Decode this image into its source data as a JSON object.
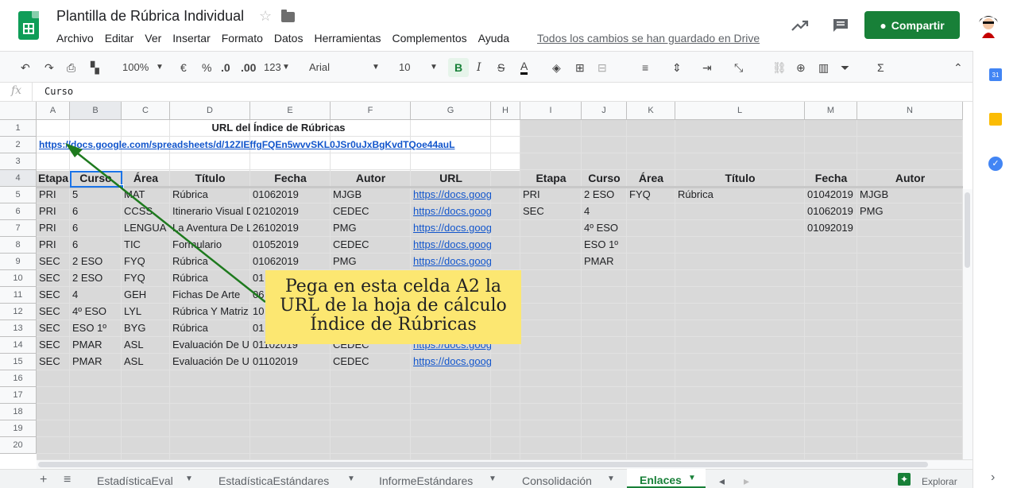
{
  "header": {
    "title": "Plantilla de Rúbrica Individual",
    "menu": [
      "Archivo",
      "Editar",
      "Ver",
      "Insertar",
      "Formato",
      "Datos",
      "Herramientas",
      "Complementos",
      "Ayuda"
    ],
    "saved_status": "Todos los cambios se han guardado en Drive",
    "share_label": "Compartir",
    "accent": "#188038"
  },
  "toolbar": {
    "zoom": "100%",
    "currency": "€",
    "percent": "%",
    "dec_less": ".0",
    "dec_more": ".00",
    "more_formats": "123",
    "font": "Arial",
    "font_size": "10",
    "bold": "B"
  },
  "formula_bar": {
    "fx": "fx",
    "value": "Curso"
  },
  "columns": [
    "A",
    "B",
    "C",
    "D",
    "E",
    "F",
    "G",
    "H",
    "I",
    "J",
    "K",
    "L",
    "M",
    "N"
  ],
  "rows": [
    "1",
    "2",
    "3",
    "4",
    "5",
    "6",
    "7",
    "8",
    "9",
    "10",
    "11",
    "12",
    "13",
    "14",
    "15",
    "16",
    "17",
    "18",
    "19",
    "20"
  ],
  "sheet": {
    "title_cell": "URL del Índice de Rúbricas",
    "url_cell": "https://docs.google.com/spreadsheets/d/12ZIEffgFQEn5wvvSKL0JSr0uJxBgKvdTQoe44auL",
    "left_headers": [
      "Etapa",
      "Curso",
      "Área",
      "Título",
      "Fecha",
      "Autor",
      "URL"
    ],
    "left_rows": [
      [
        "PRI",
        "5",
        "MAT",
        "Rúbrica",
        "01062019",
        "MJGB",
        "https://docs.goog"
      ],
      [
        "PRI",
        "6",
        "CCSS",
        "Itinerario Visual D",
        "02102019",
        "CEDEC",
        "https://docs.goog"
      ],
      [
        "PRI",
        "6",
        "LENGUA",
        "La Aventura De L",
        "26102019",
        "PMG",
        "https://docs.goog"
      ],
      [
        "PRI",
        "6",
        "TIC",
        "Formulario",
        "01052019",
        "CEDEC",
        "https://docs.goog"
      ],
      [
        "SEC",
        "2 ESO",
        "FYQ",
        "Rúbrica",
        "01062019",
        "PMG",
        "https://docs.goog"
      ],
      [
        "SEC",
        "2 ESO",
        "FYQ",
        "Rúbrica",
        "01",
        "",
        ""
      ],
      [
        "SEC",
        "4",
        "GEH",
        "Fichas De Arte",
        "06",
        "",
        ""
      ],
      [
        "SEC",
        "4º ESO",
        "LYL",
        "Rúbrica Y Matriz",
        "10",
        "",
        ""
      ],
      [
        "SEC",
        "ESO 1º",
        "BYG",
        "Rúbrica",
        "01",
        "",
        ""
      ],
      [
        "SEC",
        "PMAR",
        "ASL",
        "Evaluación De U",
        "01102019",
        "CEDEC",
        "https://docs.goog"
      ],
      [
        "SEC",
        "PMAR",
        "ASL",
        "Evaluación De U",
        "01102019",
        "CEDEC",
        "https://docs.goog"
      ]
    ],
    "right_headers": [
      "Etapa",
      "Curso",
      "Área",
      "Título",
      "Fecha",
      "Autor"
    ],
    "right_rows": [
      [
        "PRI",
        "2 ESO",
        "FYQ",
        "Rúbrica",
        "01042019",
        "MJGB"
      ],
      [
        "SEC",
        "4",
        "",
        "",
        "01062019",
        "PMG"
      ],
      [
        "",
        "4º ESO",
        "",
        "",
        "01092019",
        ""
      ],
      [
        "",
        "ESO 1º",
        "",
        "",
        "",
        ""
      ],
      [
        "",
        "PMAR",
        "",
        "",
        "",
        ""
      ]
    ]
  },
  "callout": {
    "line1": "Pega en esta celda A2 la",
    "line2": "URL de la hoja de cálculo",
    "line3": "Índice de Rúbricas"
  },
  "tabs": [
    "EstadísticaEval",
    "EstadísticaEstándares",
    "InformeEstándares",
    "Consolidación",
    "Enlaces"
  ],
  "active_tab": "Enlaces",
  "explore_label": "Explorar"
}
